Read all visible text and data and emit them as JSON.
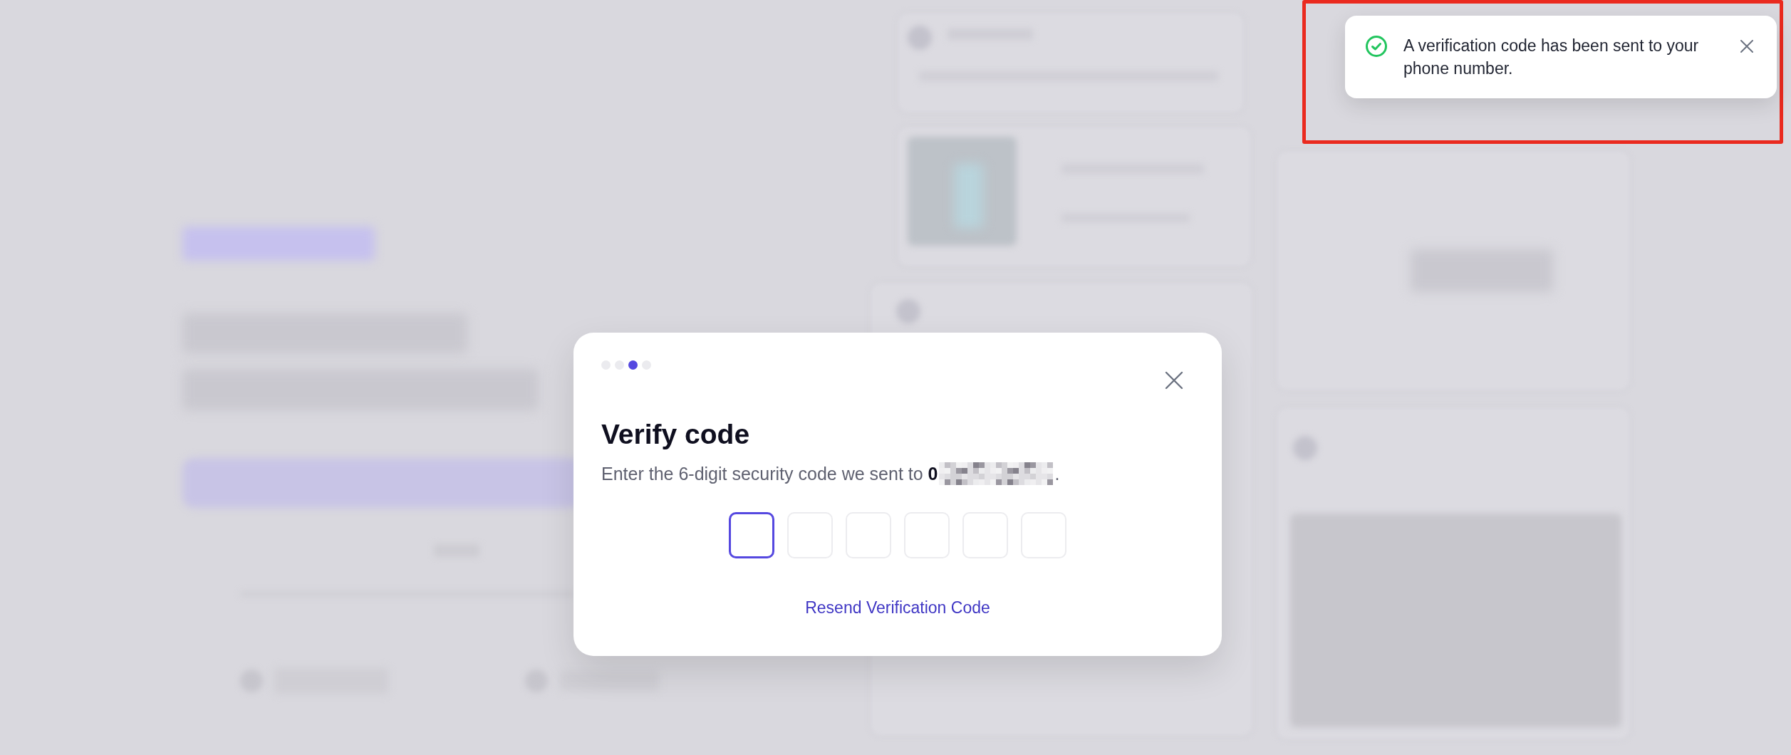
{
  "toast": {
    "kind": "success",
    "message": "A verification code has been sent to your phone number."
  },
  "annotations": [
    {
      "kind": "frame"
    }
  ],
  "dialog": {
    "steps": [
      {
        "selected": false
      },
      {
        "selected": false
      },
      {
        "selected": true
      },
      {
        "selected": false
      }
    ],
    "title": "Verify code",
    "description": "Enter the 6-digit security code we sent to **0**",
    "phone_redacted": true,
    "description_end": ".",
    "code_fields": [
      {
        "focused": true
      },
      {
        "focused": false
      },
      {
        "focused": false
      },
      {
        "focused": false
      },
      {
        "focused": false
      },
      {
        "focused": false
      }
    ],
    "resend_link": "Resend Verification Code"
  }
}
